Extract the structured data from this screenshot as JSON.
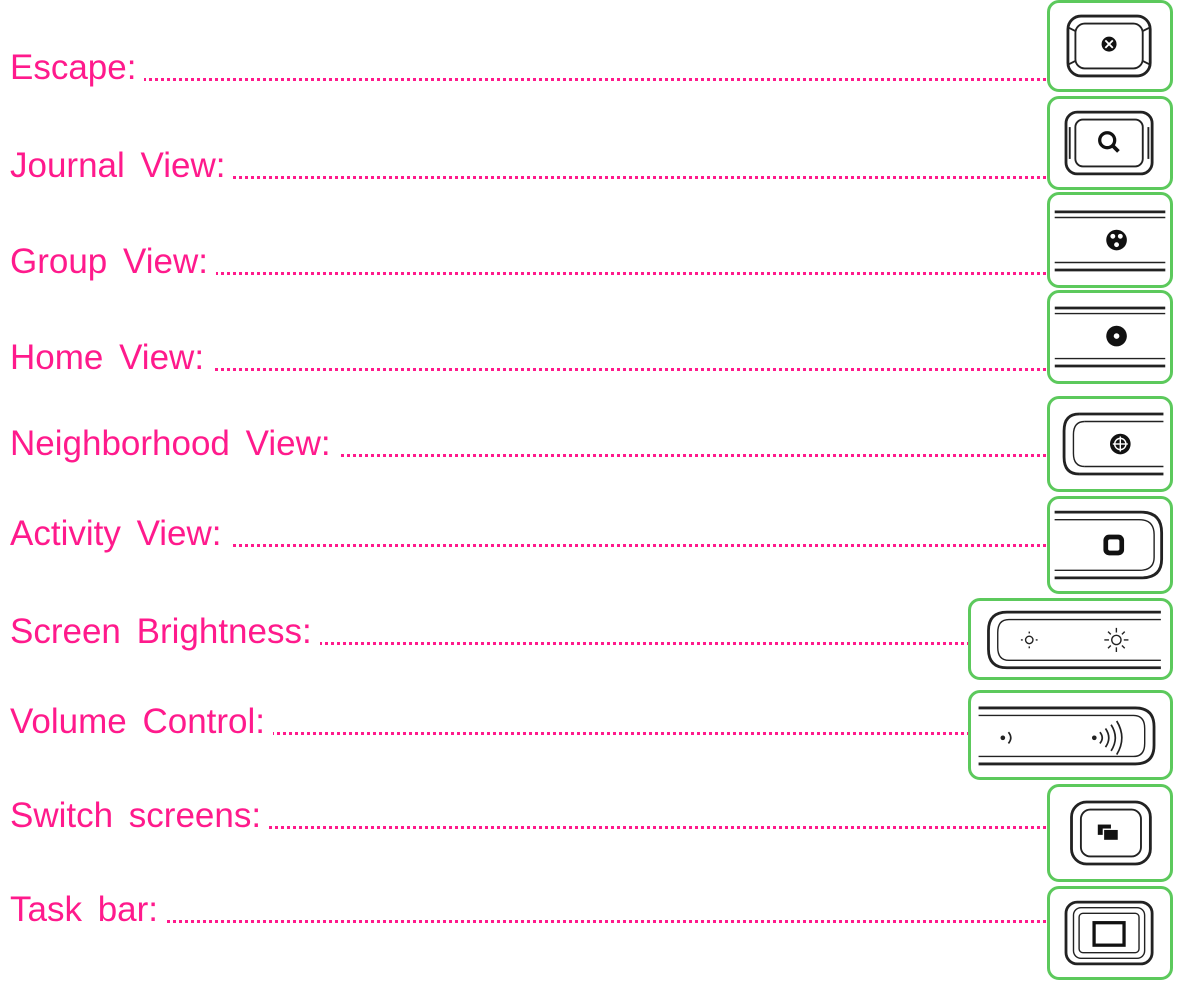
{
  "accent_color": "#ff1a8c",
  "frame_color": "#5cc95c",
  "items": [
    {
      "label": "Escape:",
      "icon": "escape-icon"
    },
    {
      "label": "Journal View:",
      "icon": "search-icon"
    },
    {
      "label": "Group View:",
      "icon": "group-icon"
    },
    {
      "label": "Home View:",
      "icon": "home-icon"
    },
    {
      "label": "Neighborhood View:",
      "icon": "neighborhood-icon"
    },
    {
      "label": "Activity View:",
      "icon": "activity-icon"
    },
    {
      "label": "Screen Brightness:",
      "icon": "brightness-icon"
    },
    {
      "label": "Volume Control:",
      "icon": "volume-icon"
    },
    {
      "label": "Switch screens:",
      "icon": "switch-screens-icon"
    },
    {
      "label": "Task bar:",
      "icon": "taskbar-icon"
    }
  ]
}
